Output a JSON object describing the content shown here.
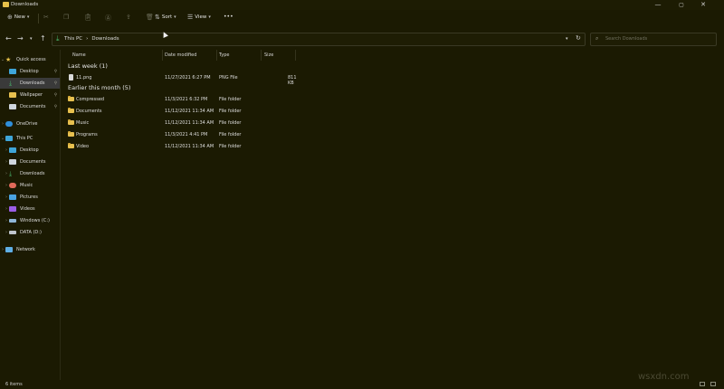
{
  "window": {
    "title": "Downloads",
    "minimize": "—",
    "maximize": "▢",
    "close": "✕"
  },
  "toolbar": {
    "new_label": "New",
    "new_chevron": "▾",
    "sort_label": "Sort",
    "sort_chevron": "▾",
    "view_label": "View",
    "view_chevron": "▾",
    "more": "•••"
  },
  "address": {
    "back": "←",
    "forward": "→",
    "recent": "▾",
    "up": "↑",
    "crumbs": [
      "This PC",
      "Downloads"
    ],
    "crumb_sep": "›",
    "dropdown": "▾",
    "refresh": "↻",
    "search_placeholder": "Search Downloads"
  },
  "sidebar": {
    "quick_access": {
      "label": "Quick access",
      "items": [
        {
          "label": "Desktop",
          "pinned": true
        },
        {
          "label": "Downloads",
          "pinned": true,
          "selected": true
        },
        {
          "label": "Wallpaper",
          "pinned": true
        },
        {
          "label": "Documents",
          "pinned": true
        }
      ]
    },
    "onedrive": "OneDrive",
    "this_pc": {
      "label": "This PC",
      "items": [
        "Desktop",
        "Documents",
        "Downloads",
        "Music",
        "Pictures",
        "Videos",
        "Windows (C:)",
        "DATA (D:)"
      ]
    },
    "network": "Network"
  },
  "columns": {
    "name": "Name",
    "date": "Date modified",
    "type": "Type",
    "size": "Size"
  },
  "groups": [
    {
      "label": "Last week (1)",
      "rows": [
        {
          "name": "11.png",
          "date": "11/27/2021 6:27 PM",
          "type": "PNG File",
          "size": "811 KB",
          "kind": "file"
        }
      ]
    },
    {
      "label": "Earlier this month (5)",
      "rows": [
        {
          "name": "Compressed",
          "date": "11/3/2021 6:32 PM",
          "type": "File folder",
          "size": "",
          "kind": "folder"
        },
        {
          "name": "Documents",
          "date": "11/12/2021 11:34 AM",
          "type": "File folder",
          "size": "",
          "kind": "folder"
        },
        {
          "name": "Music",
          "date": "11/12/2021 11:34 AM",
          "type": "File folder",
          "size": "",
          "kind": "folder"
        },
        {
          "name": "Programs",
          "date": "11/3/2021 4:41 PM",
          "type": "File folder",
          "size": "",
          "kind": "folder"
        },
        {
          "name": "Video",
          "date": "11/12/2021 11:34 AM",
          "type": "File folder",
          "size": "",
          "kind": "folder"
        }
      ]
    }
  ],
  "status": {
    "count": "6 items"
  },
  "watermark": "wsxdn.com",
  "colors": {
    "background": "#1b1a02",
    "folder": "#e7c04f",
    "selected": "#3a3a3a"
  }
}
